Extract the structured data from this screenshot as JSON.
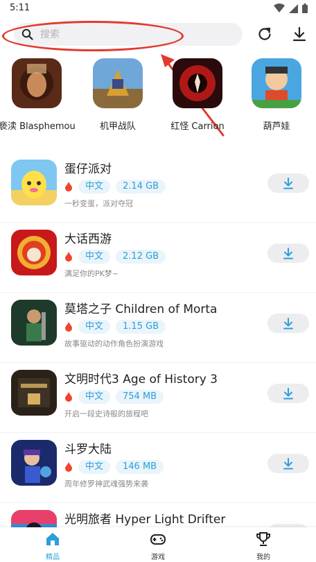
{
  "status": {
    "time": "5:11"
  },
  "search": {
    "placeholder": "搜索"
  },
  "featured": [
    {
      "label": "亵渎 Blasphemous"
    },
    {
      "label": "机甲战队"
    },
    {
      "label": "红怪 Carrion"
    },
    {
      "label": "葫芦娃"
    }
  ],
  "games": [
    {
      "title": "蛋仔派对",
      "lang": "中文",
      "size": "2.14 GB",
      "desc": "一秒变蛋，派对夺冠"
    },
    {
      "title": "大话西游",
      "lang": "中文",
      "size": "2.12 GB",
      "desc": "满足你的PK梦~"
    },
    {
      "title": "莫塔之子 Children of Morta",
      "lang": "中文",
      "size": "1.15 GB",
      "desc": "故事驱动的动作角色扮演游戏"
    },
    {
      "title": "文明时代3 Age of History 3",
      "lang": "中文",
      "size": "754 MB",
      "desc": "开启一段史诗般的旅程吧"
    },
    {
      "title": "斗罗大陆",
      "lang": "中文",
      "size": "146 MB",
      "desc": "周年修罗神武魂强势来袭"
    },
    {
      "title": "光明旅者 Hyper Light Drifter",
      "lang": "",
      "size": "",
      "desc": ""
    }
  ],
  "nav": [
    {
      "label": "精品"
    },
    {
      "label": "游戏"
    },
    {
      "label": "我的"
    }
  ],
  "colors": {
    "accent": "#2b9fd8",
    "annotation": "#e23a2e",
    "fire": "#f0442c"
  }
}
